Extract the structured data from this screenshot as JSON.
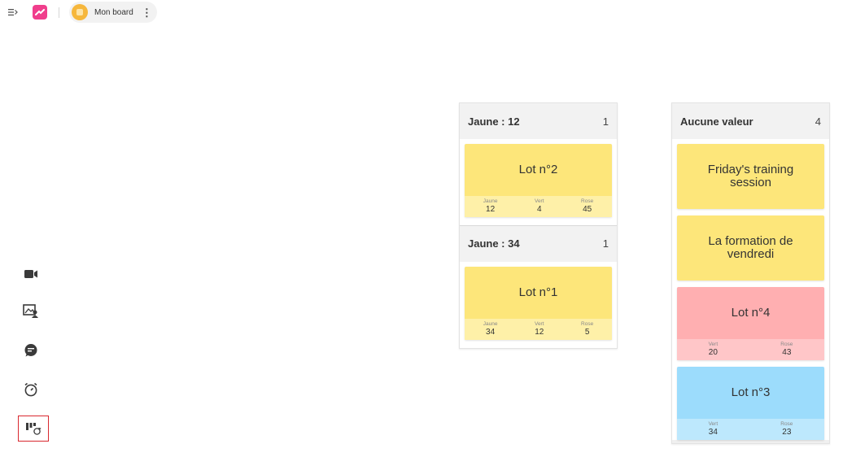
{
  "toolbar": {
    "menu_icon": "collapse-menu-icon",
    "logo_icon": "app-logo-icon",
    "board_name": "Mon board",
    "more_icon": "more-vertical-icon"
  },
  "side_tools": [
    {
      "name": "video-icon"
    },
    {
      "name": "image-user-icon"
    },
    {
      "name": "chat-icon"
    },
    {
      "name": "timer-icon"
    },
    {
      "name": "kanban-refresh-icon"
    }
  ],
  "columns": [
    {
      "groups": [
        {
          "title": "Jaune : 12",
          "count": "1",
          "cards": [
            {
              "title": "Lot n°2",
              "color": "yellow",
              "fields": [
                {
                  "label": "Jaune",
                  "value": "12"
                },
                {
                  "label": "Vert",
                  "value": "4"
                },
                {
                  "label": "Rose",
                  "value": "45"
                }
              ]
            }
          ]
        },
        {
          "title": "Jaune : 34",
          "count": "1",
          "cards": [
            {
              "title": "Lot n°1",
              "color": "yellow",
              "fields": [
                {
                  "label": "Jaune",
                  "value": "34"
                },
                {
                  "label": "Vert",
                  "value": "12"
                },
                {
                  "label": "Rose",
                  "value": "5"
                }
              ]
            }
          ]
        }
      ]
    },
    {
      "groups": [
        {
          "title": "Aucune valeur",
          "count": "4",
          "cards": [
            {
              "title": "Friday's training session",
              "color": "yellow",
              "fields": []
            },
            {
              "title": "La formation de vendredi",
              "color": "yellow",
              "fields": []
            },
            {
              "title": "Lot n°4",
              "color": "pink",
              "fields": [
                {
                  "label": "Vert",
                  "value": "20"
                },
                {
                  "label": "Rose",
                  "value": "43"
                }
              ]
            },
            {
              "title": "Lot n°3",
              "color": "blue",
              "fields": [
                {
                  "label": "Vert",
                  "value": "34"
                },
                {
                  "label": "Rose",
                  "value": "23"
                }
              ]
            }
          ]
        }
      ]
    }
  ],
  "colors": {
    "yellow": "#fde67a",
    "pink": "#ffafb1",
    "blue": "#9cdcfc",
    "accent": "#f03e8c"
  }
}
